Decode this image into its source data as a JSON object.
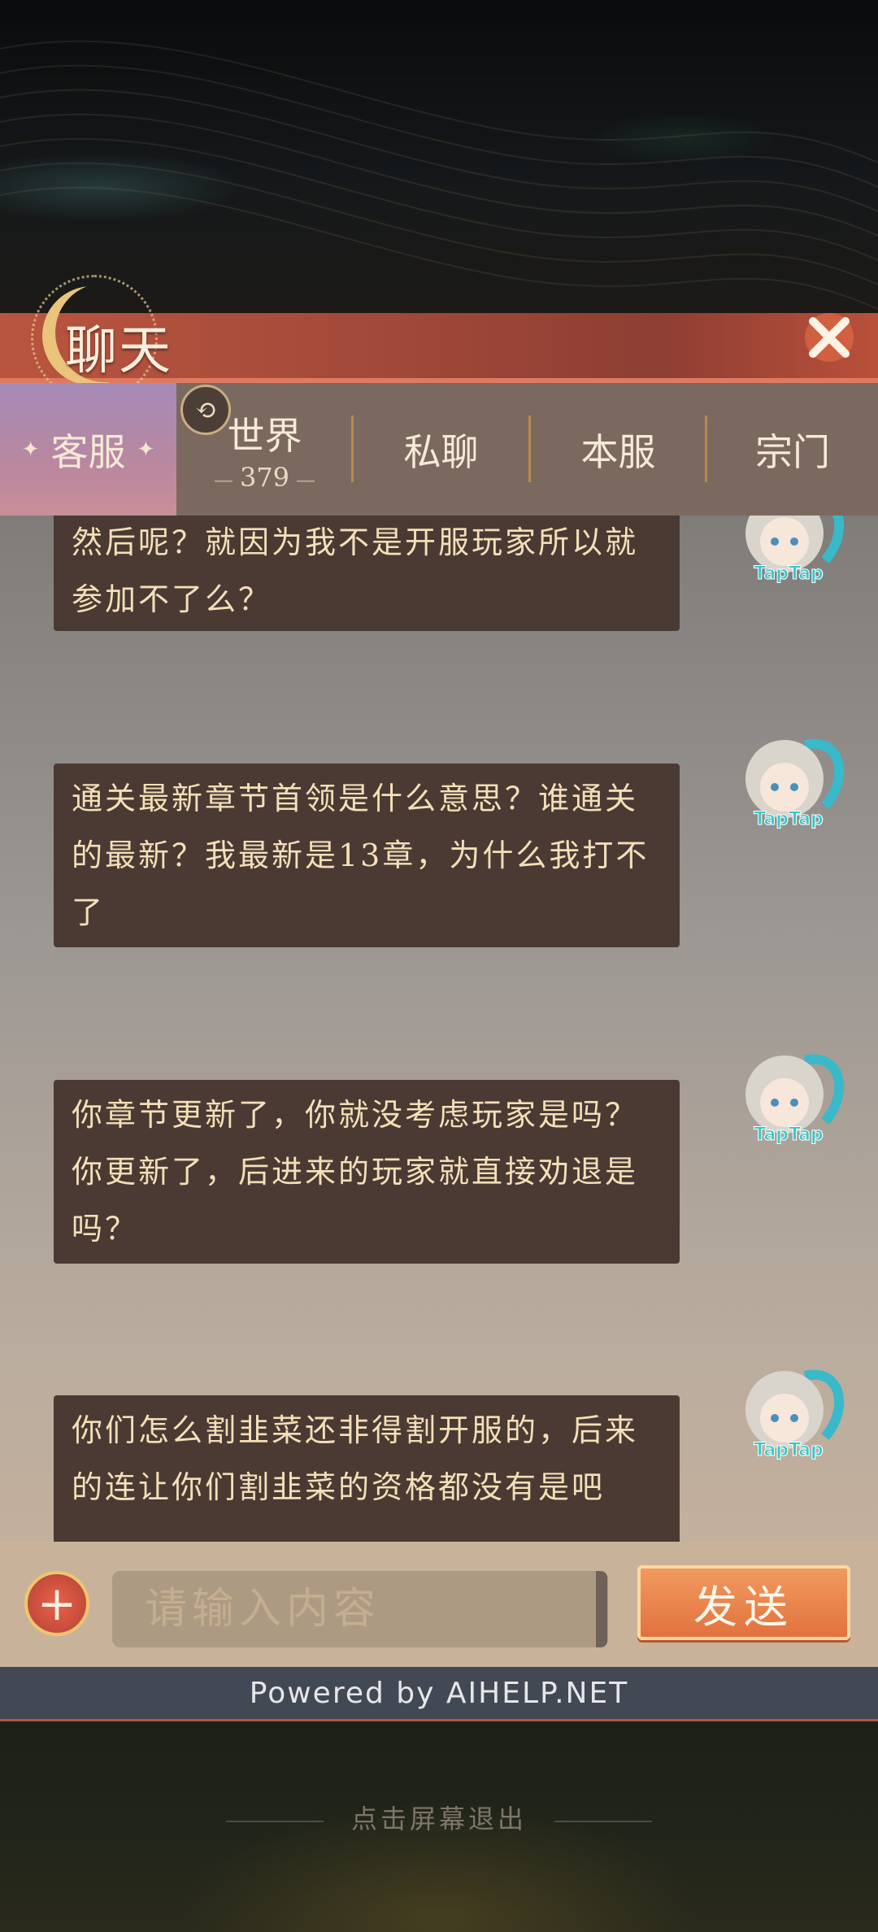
{
  "header": {
    "title": "聊天"
  },
  "tabs": [
    {
      "label": "客服",
      "active": true
    },
    {
      "label": "世界",
      "count": "379",
      "active": false
    },
    {
      "label": "私聊",
      "active": false
    },
    {
      "label": "本服",
      "active": false
    },
    {
      "label": "宗门",
      "active": false
    }
  ],
  "messages": [
    {
      "text": "然后呢？就因为我不是开服玩家所以就参加不了么？",
      "avatar": "TapTap"
    },
    {
      "text": "通关最新章节首领是什么意思？谁通关的最新？我最新是13章，为什么我打不了",
      "avatar": "TapTap"
    },
    {
      "text": "你章节更新了，你就没考虑玩家是吗？你更新了，后进来的玩家就直接劝退是吗？",
      "avatar": "TapTap"
    },
    {
      "text": "你们怎么割韭菜还非得割开服的，后来的连让你们割韭菜的资格都没有是吧",
      "avatar": "TapTap"
    }
  ],
  "input": {
    "placeholder": "请输入内容",
    "send_label": "发送"
  },
  "footer": {
    "powered_by": "Powered by AIHELP.NET",
    "exit_hint": "点击屏幕退出"
  },
  "colors": {
    "header": "#a44a3a",
    "bubble": "#4a3a33",
    "bubble_text": "#f4dfb8",
    "send": "#e2723f"
  }
}
